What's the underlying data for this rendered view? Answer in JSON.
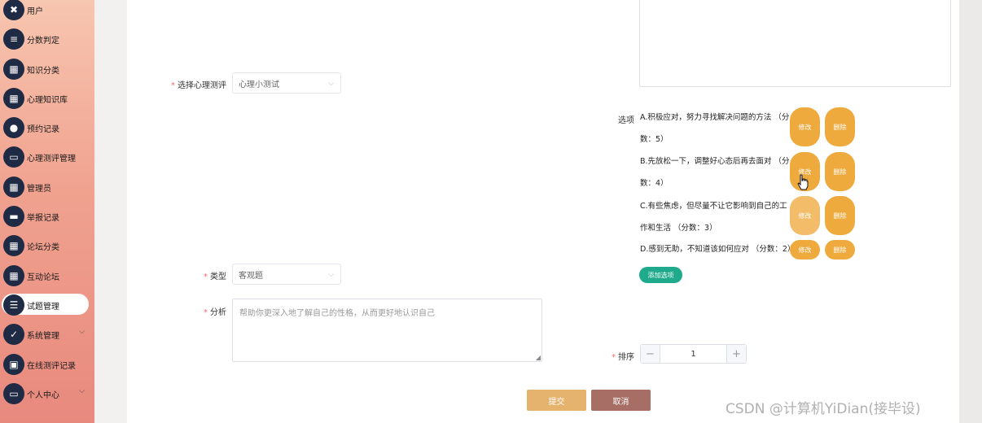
{
  "sidebar": {
    "items": [
      {
        "label": "用户",
        "icon": "ticket-icon",
        "glyph": "✖"
      },
      {
        "label": "分数判定",
        "icon": "list-icon",
        "glyph": "≡"
      },
      {
        "label": "知识分类",
        "icon": "grid-icon",
        "glyph": "▦"
      },
      {
        "label": "心理知识库",
        "icon": "grid-icon",
        "glyph": "▦"
      },
      {
        "label": "预约记录",
        "icon": "bulb-icon",
        "glyph": "●"
      },
      {
        "label": "心理测评管理",
        "icon": "monitor-icon",
        "glyph": "▭"
      },
      {
        "label": "管理员",
        "icon": "apps-icon",
        "glyph": "▦"
      },
      {
        "label": "举报记录",
        "icon": "briefcase-icon",
        "glyph": "▬"
      },
      {
        "label": "论坛分类",
        "icon": "grid-icon",
        "glyph": "▦"
      },
      {
        "label": "互动论坛",
        "icon": "grid-icon",
        "glyph": "▦"
      },
      {
        "label": "试题管理",
        "icon": "sliders-icon",
        "glyph": "☰",
        "active": true
      },
      {
        "label": "系统管理",
        "icon": "clipboard-icon",
        "glyph": "✓",
        "chevron": true
      },
      {
        "label": "在线测评记录",
        "icon": "bag-icon",
        "glyph": "▣"
      },
      {
        "label": "个人中心",
        "icon": "window-icon",
        "glyph": "▭",
        "chevron": true
      }
    ]
  },
  "form": {
    "assessment_label": "选择心理测评",
    "assessment_value": "心理小测试",
    "options_label": "选项",
    "options": [
      {
        "text": "A.积极应对，努力寻找解决问题的方法 （分数：5）",
        "edit": "修改",
        "delete": "删除"
      },
      {
        "text": "B.先放松一下，调整好心态后再去面对 （分数：4）",
        "edit": "修改",
        "delete": "删除"
      },
      {
        "text": "C.有些焦虑，但尽量不让它影响到自己的工作和生活 （分数：3）",
        "edit": "修改",
        "delete": "删除"
      },
      {
        "text": "D.感到无助，不知道该如何应对 （分数：2）",
        "edit": "修改",
        "delete": "删除"
      }
    ],
    "add_option": "添加选项",
    "type_label": "类型",
    "type_value": "客观题",
    "analysis_label": "分析",
    "analysis_placeholder": "帮助你更深入地了解自己的性格，从而更好地认识自己",
    "order_label": "排序",
    "order_value": "1",
    "submit": "提交",
    "cancel": "取消"
  },
  "watermark": "CSDN @计算机YiDian(接毕设)",
  "colors": {
    "accent": "#eeaa3d",
    "add_button": "#1eaa8b",
    "submit": "#e6b36f",
    "cancel": "#a66e64",
    "sidebar_icon": "#1f2a44"
  }
}
